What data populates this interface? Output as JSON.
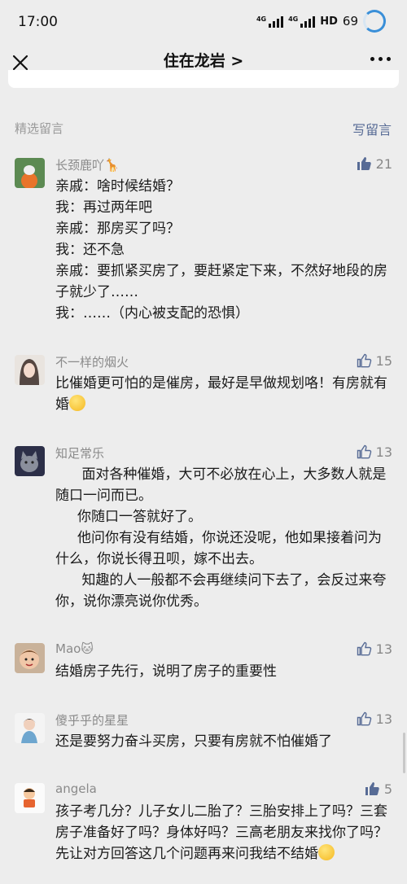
{
  "status": {
    "time": "17:00",
    "network1": "4G",
    "network2": "4G",
    "hd": "HD",
    "battery": "69"
  },
  "nav": {
    "title": "住在龙岩 >",
    "close_icon": "close-icon",
    "more_icon": "more-icon"
  },
  "section": {
    "title": "精选留言",
    "write": "写留言"
  },
  "comments": [
    {
      "nick": "长颈鹿吖🦒",
      "likes": "21",
      "liked": true,
      "text": "亲戚：啥时候结婚？\n我：再过两年吧\n亲戚：那房买了吗？\n我：还不急\n亲戚：要抓紧买房了，要赶紧定下来，不然好地段的房子就少了……\n我：……（内心被支配的恐惧）"
    },
    {
      "nick": "不一样的烟火",
      "likes": "15",
      "liked": false,
      "text": "比催婚更可怕的是催房，最好是早做规划咯！有房就有婚"
    },
    {
      "nick": "知足常乐",
      "likes": "13",
      "liked": false,
      "text": "      面对各种催婚，大可不必放在心上，大多数人就是随口一问而已。\n     你随口一答就好了。\n     他问你有没有结婚，你说还没呢，他如果接着问为什么，你说长得丑呗，嫁不出去。\n      知趣的人一般都不会再继续问下去了，会反过来夸你，说你漂亮说你优秀。"
    },
    {
      "nick": "Mao🐱",
      "likes": "13",
      "liked": false,
      "text": "结婚房子先行，说明了房子的重要性"
    },
    {
      "nick": "傻乎乎的星星",
      "likes": "13",
      "liked": false,
      "text": "还是要努力奋斗买房，只要有房就不怕催婚了"
    },
    {
      "nick": "angela",
      "likes": "5",
      "liked": true,
      "text": "孩子考几分？儿子女儿二胎了？三胎安排上了吗？三套房子准备好了吗？身体好吗？三高老朋友来找你了吗？先让对方回答这几个问题再来问我结不结婚"
    }
  ],
  "colors": {
    "link": "#576b95",
    "liked": "#576b95",
    "muted": "#8a8a8a",
    "background": "#ededed"
  }
}
